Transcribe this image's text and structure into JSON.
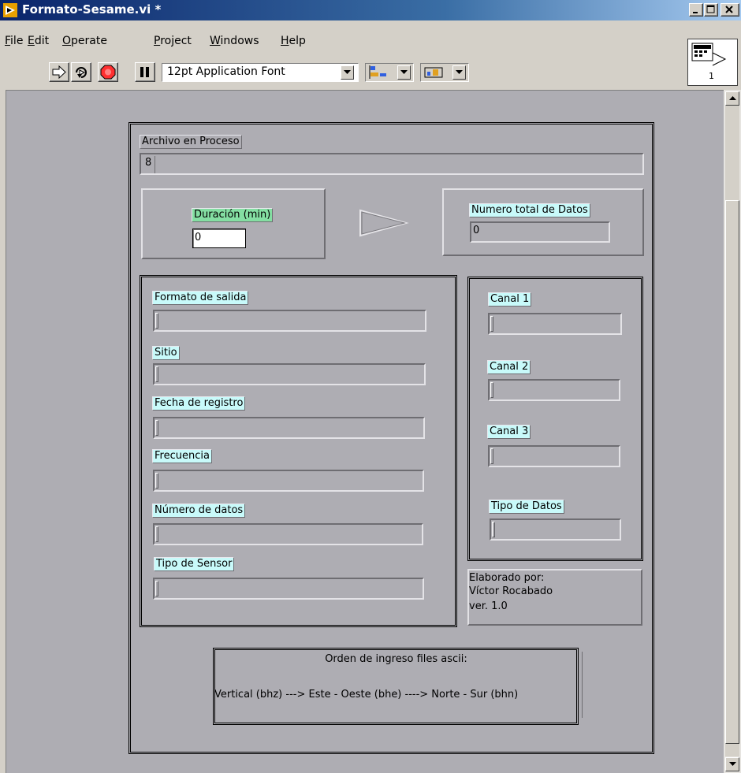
{
  "window": {
    "title": "Formato-Sesame.vi *"
  },
  "menubar": {
    "items": [
      {
        "mnemonic": "F",
        "rest": "ile"
      },
      {
        "mnemonic": "E",
        "rest": "dit"
      },
      {
        "mnemonic": "O",
        "rest": "perate"
      },
      {
        "mnemonic": "P",
        "rest": "roject"
      },
      {
        "mnemonic": "W",
        "rest": "indows"
      },
      {
        "mnemonic": "H",
        "rest": "elp"
      }
    ]
  },
  "toolbar": {
    "font_selector_value": "12pt Application Font"
  },
  "vi_icon": {
    "connector_number": "1"
  },
  "front_panel": {
    "archivo": {
      "label": "Archivo en Proceso",
      "path_glyph": "8",
      "value": ""
    },
    "duracion": {
      "label": "Duración (min)",
      "value": "0"
    },
    "total_datos": {
      "label": "Numero total de Datos",
      "value": "0"
    },
    "header_fields": [
      {
        "label": "Formato de salida",
        "value": ""
      },
      {
        "label": "Sitio",
        "value": ""
      },
      {
        "label": "Fecha de registro",
        "value": ""
      },
      {
        "label": "Frecuencia",
        "value": ""
      },
      {
        "label": "Número de datos",
        "value": ""
      },
      {
        "label": "Tipo de Sensor",
        "value": ""
      }
    ],
    "channel_fields": [
      {
        "label": "Canal 1",
        "value": ""
      },
      {
        "label": "Canal 2",
        "value": ""
      },
      {
        "label": "Canal 3",
        "value": ""
      },
      {
        "label": "Tipo de Datos",
        "value": ""
      }
    ],
    "credits": {
      "line1": "Elaborado por:",
      "line2": "Víctor Rocabado",
      "line3": "ver. 1.0"
    },
    "order_note": {
      "title": "Orden de ingreso files ascii:",
      "sequence": "Vertical (bhz) ---> Este - Oeste (bhe) ----> Norte - Sur (bhn)"
    }
  },
  "colors": {
    "panel_bg": "#aeadb3",
    "label_cyan": "#c8fafa",
    "label_green": "#84dea2",
    "titlebar_start": "#0a246a",
    "titlebar_end": "#a6caf0"
  }
}
